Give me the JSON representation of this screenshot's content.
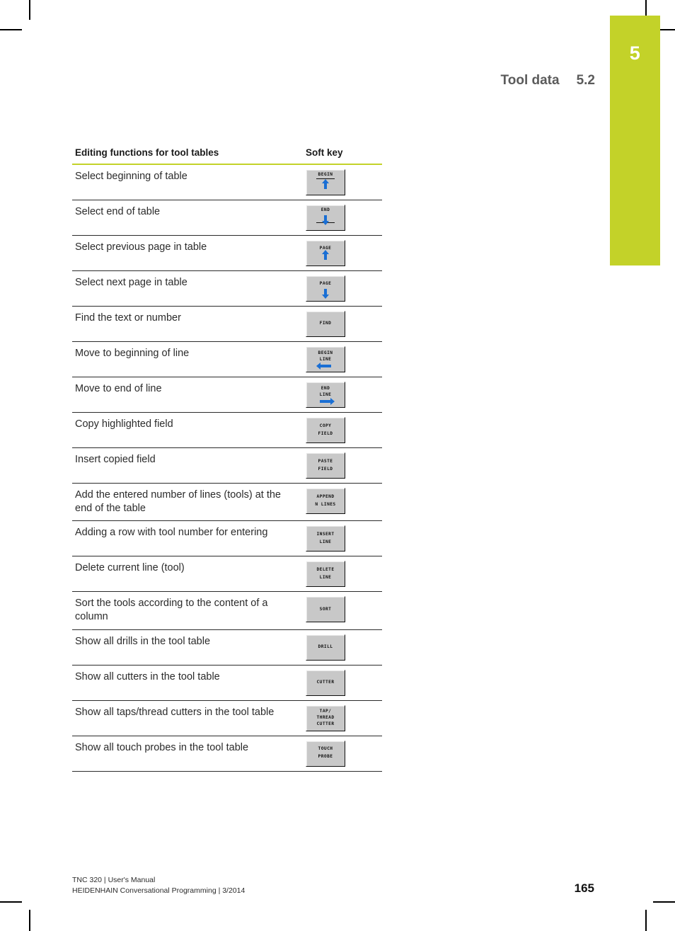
{
  "chapter_tab": {
    "number": "5",
    "color": "#c3d229"
  },
  "running_head": {
    "title": "Tool data",
    "section": "5.2"
  },
  "table": {
    "headers": {
      "description": "Editing functions for tool tables",
      "softkey": "Soft key"
    },
    "rows": [
      {
        "description": "Select beginning of table",
        "softkey": {
          "lines": [
            "BEGIN"
          ],
          "glyph": "rule-below-then-arrow-up",
          "icon_name": "begin-of-table-softkey"
        }
      },
      {
        "description": "Select end of table",
        "softkey": {
          "lines": [
            "END"
          ],
          "glyph": "arrow-down-then-rule",
          "icon_name": "end-of-table-softkey"
        }
      },
      {
        "description": "Select previous page in table",
        "softkey": {
          "lines": [
            "PAGE"
          ],
          "glyph": "arrow-up",
          "icon_name": "page-up-softkey"
        }
      },
      {
        "description": "Select next page in table",
        "softkey": {
          "lines": [
            "PAGE"
          ],
          "glyph": "arrow-down",
          "icon_name": "page-down-softkey"
        }
      },
      {
        "description": "Find the text or number",
        "softkey": {
          "lines": [
            "FIND"
          ],
          "glyph": "none",
          "icon_name": "find-softkey"
        }
      },
      {
        "description": "Move to beginning of line",
        "softkey": {
          "lines": [
            "BEGIN",
            "LINE"
          ],
          "glyph": "arrow-left",
          "icon_name": "begin-line-softkey"
        }
      },
      {
        "description": "Move to end of line",
        "softkey": {
          "lines": [
            "END",
            "LINE"
          ],
          "glyph": "arrow-right",
          "icon_name": "end-line-softkey"
        }
      },
      {
        "description": "Copy highlighted field",
        "softkey": {
          "lines": [
            "COPY",
            "FIELD"
          ],
          "glyph": "none",
          "icon_name": "copy-field-softkey"
        }
      },
      {
        "description": "Insert copied field",
        "softkey": {
          "lines": [
            "PASTE",
            "FIELD"
          ],
          "glyph": "none",
          "icon_name": "paste-field-softkey"
        }
      },
      {
        "description": "Add the entered number of lines (tools) at the end of the table",
        "softkey": {
          "lines": [
            "APPEND",
            "N LINES"
          ],
          "glyph": "none",
          "icon_name": "append-n-lines-softkey"
        }
      },
      {
        "description": "Adding a row with tool number for entering",
        "softkey": {
          "lines": [
            "INSERT",
            "LINE"
          ],
          "glyph": "none",
          "icon_name": "insert-line-softkey"
        }
      },
      {
        "description": "Delete current line (tool)",
        "softkey": {
          "lines": [
            "DELETE",
            "LINE"
          ],
          "glyph": "none",
          "icon_name": "delete-line-softkey"
        }
      },
      {
        "description": "Sort the tools according to the content of a column",
        "softkey": {
          "lines": [
            "SORT"
          ],
          "glyph": "none",
          "icon_name": "sort-softkey"
        }
      },
      {
        "description": "Show all drills in the tool table",
        "softkey": {
          "lines": [
            "DRILL"
          ],
          "glyph": "none",
          "icon_name": "drill-filter-softkey"
        }
      },
      {
        "description": "Show all cutters in the tool table",
        "softkey": {
          "lines": [
            "CUTTER"
          ],
          "glyph": "none",
          "icon_name": "cutter-filter-softkey"
        }
      },
      {
        "description": "Show all taps/thread cutters in the tool table",
        "softkey": {
          "lines": [
            "TAP/",
            "THREAD",
            "CUTTER"
          ],
          "glyph": "none",
          "icon_name": "tap-thread-cutter-filter-softkey"
        }
      },
      {
        "description": "Show all touch probes in the tool table",
        "softkey": {
          "lines": [
            "TOUCH",
            "PROBE"
          ],
          "glyph": "none",
          "icon_name": "touch-probe-filter-softkey"
        }
      }
    ]
  },
  "footer": {
    "line1": "TNC 320 | User's Manual",
    "line2": "HEIDENHAIN Conversational Programming | 3/2014",
    "page_number": "165"
  },
  "colors": {
    "accent": "#c3d229",
    "arrow_blue": "#1a6fd4",
    "softkey_face": "#c8c8c8",
    "running_head_text": "#5b5b5b"
  }
}
